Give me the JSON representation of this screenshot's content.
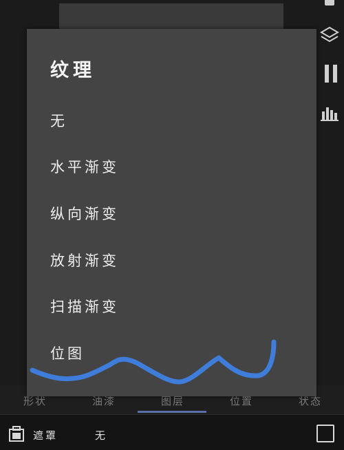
{
  "dialog": {
    "title": "纹理",
    "options": [
      "无",
      "水平渐变",
      "纵向渐变",
      "放射渐变",
      "扫描渐变",
      "位图"
    ]
  },
  "tabs": [
    "形状",
    "油漆",
    "图层",
    "位置",
    "状态"
  ],
  "active_tab": "图层",
  "bottom_bar": {
    "mask_label": "遮罩",
    "mask_value": "无"
  },
  "icons": [
    "layers-icon",
    "bars-icon",
    "stats-icon",
    "mask-icon",
    "checkbox"
  ],
  "colors": {
    "dialog_bg": "#444444",
    "scribble": "#3f7ddb",
    "tab_indicator": "#5b6fa8"
  }
}
